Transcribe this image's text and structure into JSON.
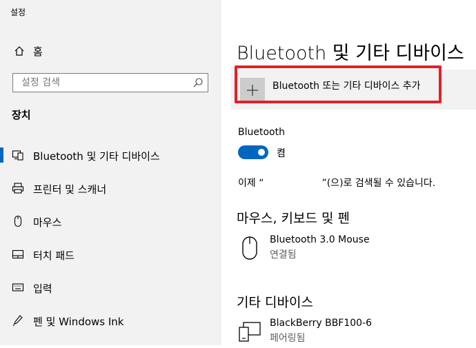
{
  "window": {
    "title": "설정"
  },
  "sidebar": {
    "home_label": "홈",
    "search_placeholder": "설정 검색",
    "section_title": "장치",
    "items": [
      {
        "label": "Bluetooth 및 기타 디바이스",
        "icon": "bluetooth-devices-icon",
        "active": true
      },
      {
        "label": "프린터 및 스캐너",
        "icon": "printer-icon"
      },
      {
        "label": "마우스",
        "icon": "mouse-icon"
      },
      {
        "label": "터치 패드",
        "icon": "touchpad-icon"
      },
      {
        "label": "입력",
        "icon": "keyboard-icon"
      },
      {
        "label": "펜 및 Windows Ink",
        "icon": "pen-icon"
      }
    ]
  },
  "main": {
    "title": "Bluetooth 및 기타 디바이스",
    "add_device_label": "Bluetooth 또는 기타 디바이스 추가",
    "bluetooth_label": "Bluetooth",
    "toggle_state": "켬",
    "discover_prefix": "이제 “",
    "discover_suffix": "”(으)로 검색될 수 있습니다.",
    "mouse_section_title": "마우스, 키보드 및 펜",
    "mouse_device": {
      "name": "Bluetooth 3.0 Mouse",
      "status": "연결됨"
    },
    "other_section_title": "기타 디바이스",
    "other_device": {
      "name": "BlackBerry BBF100-6",
      "status": "페어링됨"
    }
  },
  "colors": {
    "accent": "#0067c0",
    "highlight": "#e32028",
    "sidebar_bg": "#f2f2f2"
  }
}
